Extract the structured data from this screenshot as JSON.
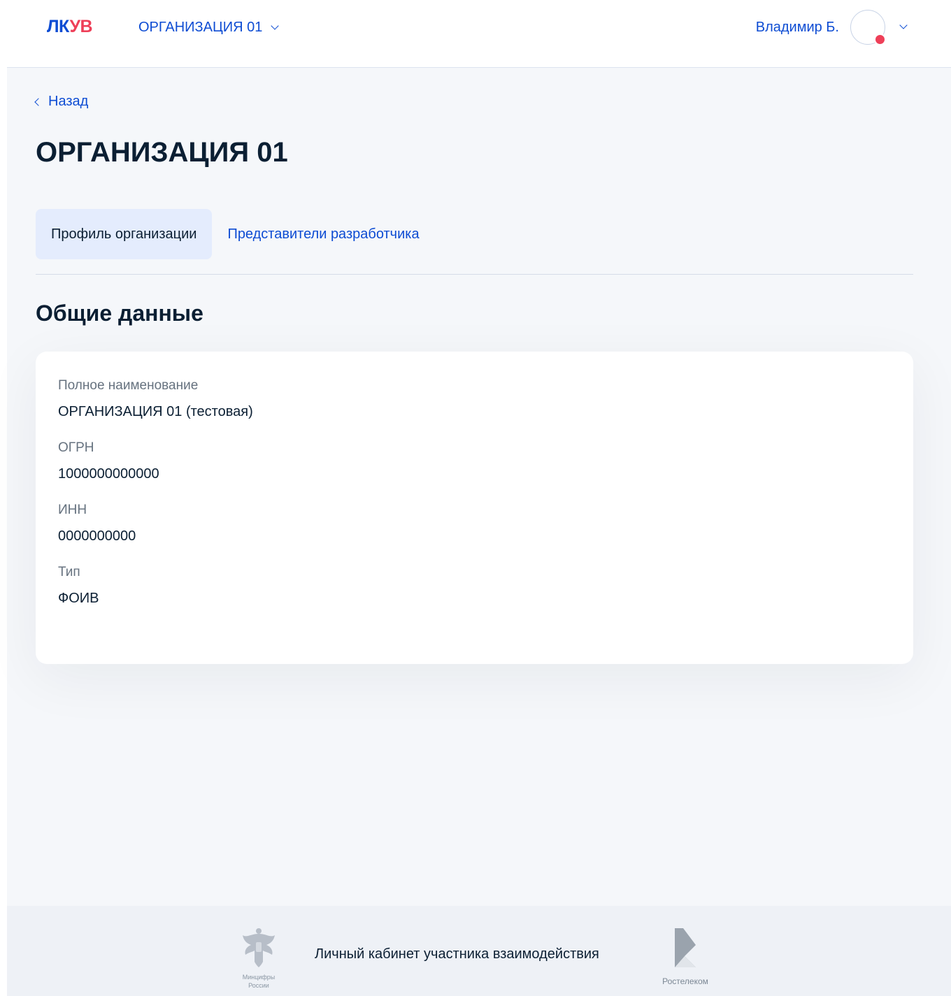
{
  "header": {
    "logo_part1": "ЛК",
    "logo_part2": "УВ",
    "org_switch_label": "ОРГАНИЗАЦИЯ 01",
    "user_name": "Владимир Б."
  },
  "nav": {
    "back_label": "Назад"
  },
  "main": {
    "page_title": "ОРГАНИЗАЦИЯ 01",
    "tabs": [
      {
        "label": "Профиль организации",
        "active": true
      },
      {
        "label": "Представители разработчика",
        "active": false
      }
    ],
    "section_title": "Общие данные",
    "fields": [
      {
        "label": "Полное наименование",
        "value": "ОРГАНИЗАЦИЯ 01 (тестовая)"
      },
      {
        "label": "ОГРН",
        "value": "1000000000000"
      },
      {
        "label": "ИНН",
        "value": "0000000000"
      },
      {
        "label": "Тип",
        "value": "ФОИВ"
      }
    ]
  },
  "footer": {
    "left_logo_caption_1": "Минцифры",
    "left_logo_caption_2": "России",
    "text": "Личный кабинет участника взаимодействия",
    "right_logo_caption": "Ростелеком"
  },
  "colors": {
    "accent": "#0d4cd3",
    "brand_red": "#ee3f58",
    "background": "#f5f7fa",
    "tab_active_bg": "#e4ecfd"
  }
}
